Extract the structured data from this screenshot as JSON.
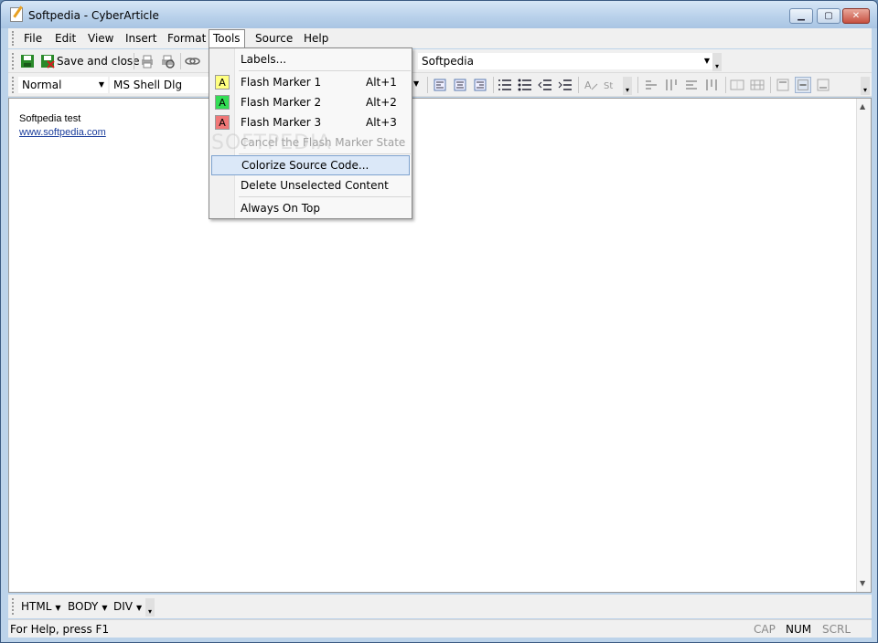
{
  "window": {
    "title": "Softpedia - CyberArticle"
  },
  "menubar": [
    "File",
    "Edit",
    "View",
    "Insert",
    "Format",
    "Tools",
    "Source",
    "Help"
  ],
  "toolbar1": {
    "save_close_label": "Save and close",
    "url_value": "Softpedia"
  },
  "toolbar2": {
    "style_value": "Normal",
    "font_value": "MS Shell Dlg"
  },
  "tools_menu": {
    "labels": "Labels...",
    "marker1": {
      "label": "Flash Marker 1",
      "shortcut": "Alt+1",
      "glyph": "A",
      "color": "#ffff80"
    },
    "marker2": {
      "label": "Flash Marker 2",
      "shortcut": "Alt+2",
      "glyph": "A",
      "color": "#33dd55"
    },
    "marker3": {
      "label": "Flash Marker 3",
      "shortcut": "Alt+3",
      "glyph": "A",
      "color": "#f07777"
    },
    "cancel": "Cancel the Flash Marker State",
    "colorize": "Colorize Source Code...",
    "delete_unselected": "Delete Unselected Content",
    "always_on_top": "Always On Top"
  },
  "editor": {
    "line1": "Softpedia test",
    "line2": "www.softpedia.com"
  },
  "pathbar": [
    "HTML",
    "BODY",
    "DIV"
  ],
  "status": {
    "text": "For Help, press F1",
    "cap": "CAP",
    "num": "NUM",
    "scrl": "SCRL"
  },
  "watermark": "SOFTPEDIA"
}
